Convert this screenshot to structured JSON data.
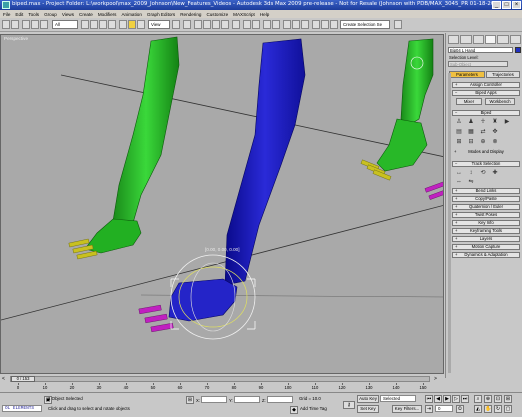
{
  "window": {
    "file": "biped.max",
    "title": "biped.max - Project Folder: L:\\workpool\\max_2009_Johnson\\New_Features_Videos - Autodesk 3ds Max 2009 pre-release - Not for Resale (Johnson with PDB/MAX_3045_PR 01-18-20...",
    "minimize": "_",
    "maximize": "□",
    "close": "×"
  },
  "menu": [
    "File",
    "Edit",
    "Tools",
    "Group",
    "Views",
    "Create",
    "Modifiers",
    "Animation",
    "Graph Editors",
    "Rendering",
    "Customize",
    "MAXScript",
    "Help"
  ],
  "toolbar": {
    "filter": "All",
    "coord_system": "View",
    "named_selection": "Create Selection Se"
  },
  "viewport": {
    "label": "Perspective",
    "transform_readout": "[0.00, 0.00, 0.00]"
  },
  "command_panel": {
    "object_name": "Bip04 L Hand",
    "swatch_color": "#2030c0",
    "selection_level_label": "Selection Level:",
    "sub_object": "Sub-Object",
    "params_tab": "Parameters",
    "trajectories_tab": "Trajectories",
    "rollouts": {
      "assign_controller": "Assign Controller",
      "biped_apps": "Biped Apps",
      "biped": "Biped",
      "modes_display": "Modes and Display",
      "track_selection": "Track Selection",
      "bend_links": "Bend Links",
      "copy_paste": "Copy/Paste",
      "quaternion": "Quaternion / Euler",
      "twist_poses": "Twist Poses",
      "key_info": "Key Info",
      "keyframing_tools": "Keyframing Tools",
      "layers": "Layers",
      "motion_capture": "Motion Capture",
      "dynamics": "Dynamics & Adaptation"
    },
    "mixer_btn": "Mixer",
    "workbench_btn": "Workbench"
  },
  "timeline": {
    "frame_display": "0 / 153",
    "ticks": [
      "0",
      "10",
      "20",
      "30",
      "40",
      "50",
      "60",
      "70",
      "80",
      "90",
      "100",
      "110",
      "120",
      "130",
      "140",
      "150"
    ]
  },
  "status": {
    "listener": "OL ELEMENTS",
    "objects_selected": "1 Object Selected",
    "prompt": "Click and drag to select and rotate objects",
    "x_label": "X:",
    "y_label": "Y:",
    "z_label": "Z:",
    "grid": "Grid = 10.0",
    "add_time_tag": "Add Time Tag",
    "auto_key": "Auto Key",
    "set_key": "Set Key",
    "key_mode_value": "Selected",
    "key_filters": "Key Filters...",
    "frame_value": "0"
  }
}
